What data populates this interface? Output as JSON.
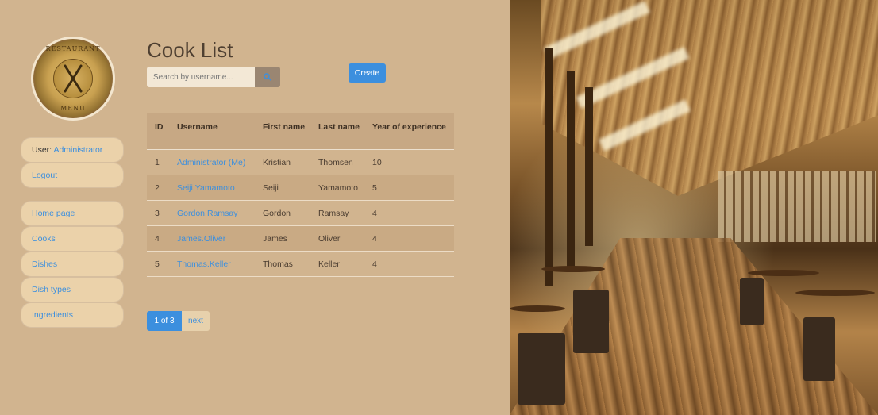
{
  "logo": {
    "top_text": "RESTAURANT",
    "bottom_text": "MENU"
  },
  "sidebar": {
    "user_label": "User:",
    "user_name": "Administrator",
    "logout": "Logout",
    "nav": [
      {
        "label": "Home page"
      },
      {
        "label": "Cooks"
      },
      {
        "label": "Dishes"
      },
      {
        "label": "Dish types"
      },
      {
        "label": "Ingredients"
      }
    ]
  },
  "main": {
    "title": "Cook List",
    "search": {
      "placeholder": "Search by username..."
    },
    "create_label": "Create",
    "table": {
      "headers": [
        "ID",
        "Username",
        "First name",
        "Last name",
        "Year of experience"
      ],
      "rows": [
        {
          "id": "1",
          "username": "Administrator (Me)",
          "first": "Kristian",
          "last": "Thomsen",
          "years": "10"
        },
        {
          "id": "2",
          "username": "Seiji.Yamamoto",
          "first": "Seiji",
          "last": "Yamamoto",
          "years": "5"
        },
        {
          "id": "3",
          "username": "Gordon.Ramsay",
          "first": "Gordon",
          "last": "Ramsay",
          "years": "4"
        },
        {
          "id": "4",
          "username": "James.Oliver",
          "first": "James",
          "last": "Oliver",
          "years": "4"
        },
        {
          "id": "5",
          "username": "Thomas.Keller",
          "first": "Thomas",
          "last": "Keller",
          "years": "4"
        }
      ]
    },
    "pagination": {
      "current": "1 of 3",
      "next": "next"
    }
  },
  "colors": {
    "background": "#d1b48f",
    "accent": "#3c8fde",
    "sidebar_button": "#ebd2aa",
    "title": "#4e3f31"
  },
  "icons": {
    "logo": "restaurant-logo-icon",
    "search": "search-icon"
  }
}
